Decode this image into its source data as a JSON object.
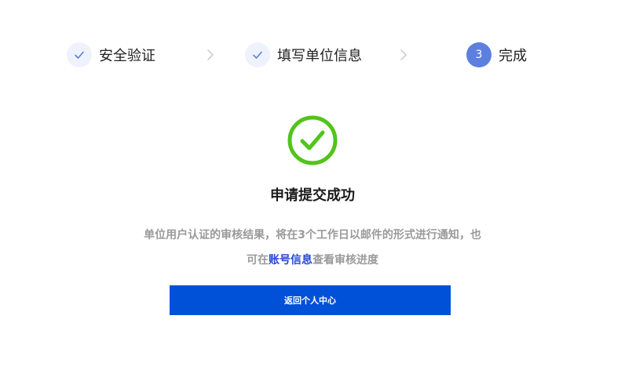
{
  "steps": [
    {
      "label": "安全验证",
      "state": "done",
      "icon": "check-icon"
    },
    {
      "label": "填写单位信息",
      "state": "done",
      "icon": "check-icon"
    },
    {
      "label": "完成",
      "state": "active",
      "number": "3"
    }
  ],
  "result": {
    "icon": "success-check-circle-icon",
    "title": "申请提交成功",
    "desc_line1": "单位用户认证的审核结果，将在3个工作日以邮件的形式进行通知，也",
    "desc_line2_prefix": "可在",
    "desc_line2_link": "账号信息",
    "desc_line2_suffix": "查看审核进度"
  },
  "actions": {
    "primary_label": "返回个人中心"
  },
  "colors": {
    "primary": "#0050d8",
    "success": "#52c41a",
    "step_active": "#5c7fe0",
    "step_done_bg": "#eef2fc",
    "link": "#2848d8",
    "muted_text": "#9a9a9a"
  }
}
